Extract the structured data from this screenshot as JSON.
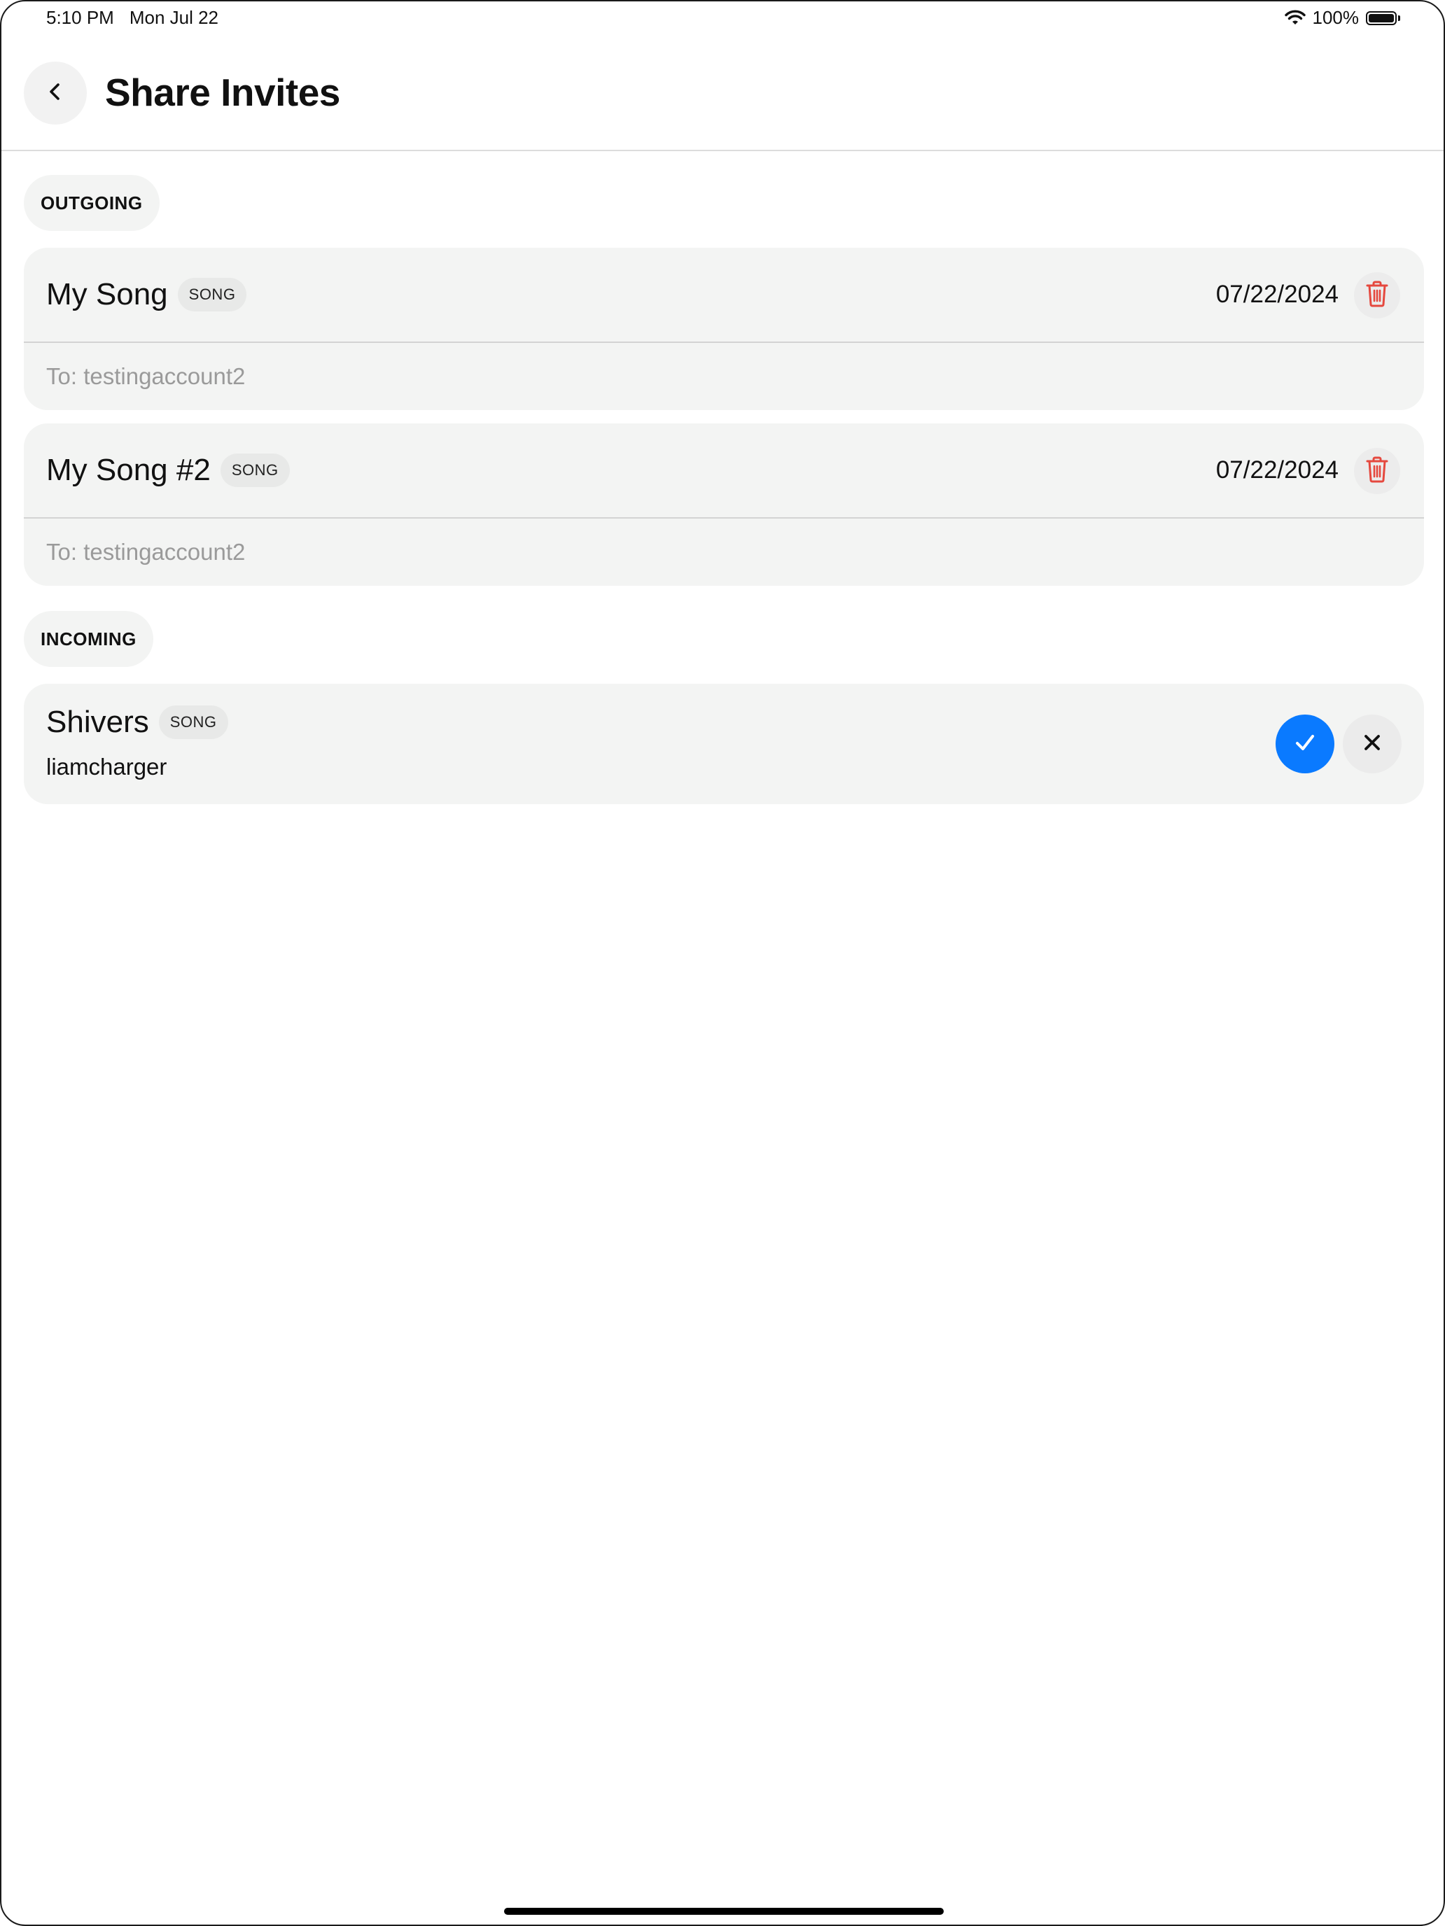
{
  "status_bar": {
    "time": "5:10 PM",
    "date": "Mon Jul 22",
    "battery_percent": "100%",
    "battery_level": 1.0,
    "icons": [
      "wifi-icon",
      "battery-icon"
    ]
  },
  "header": {
    "title": "Share Invites",
    "back_icon": "chevron-left-icon"
  },
  "outgoing": {
    "label": "OUTGOING",
    "items": [
      {
        "title": "My Song",
        "type": "SONG",
        "date": "07/22/2024",
        "recipient": "To: testingaccount2",
        "action_icon": "trash-icon"
      },
      {
        "title": "My Song #2",
        "type": "SONG",
        "date": "07/22/2024",
        "recipient": "To: testingaccount2",
        "action_icon": "trash-icon"
      }
    ]
  },
  "incoming": {
    "label": "INCOMING",
    "items": [
      {
        "title": "Shivers",
        "type": "SONG",
        "sender": "liamcharger",
        "accept_icon": "checkmark-icon",
        "decline_icon": "close-icon"
      }
    ]
  },
  "colors": {
    "accent": "#0a7aff",
    "destructive": "#e5483e",
    "card_background": "#f3f4f3",
    "secondary_text": "#9a9a9a"
  }
}
